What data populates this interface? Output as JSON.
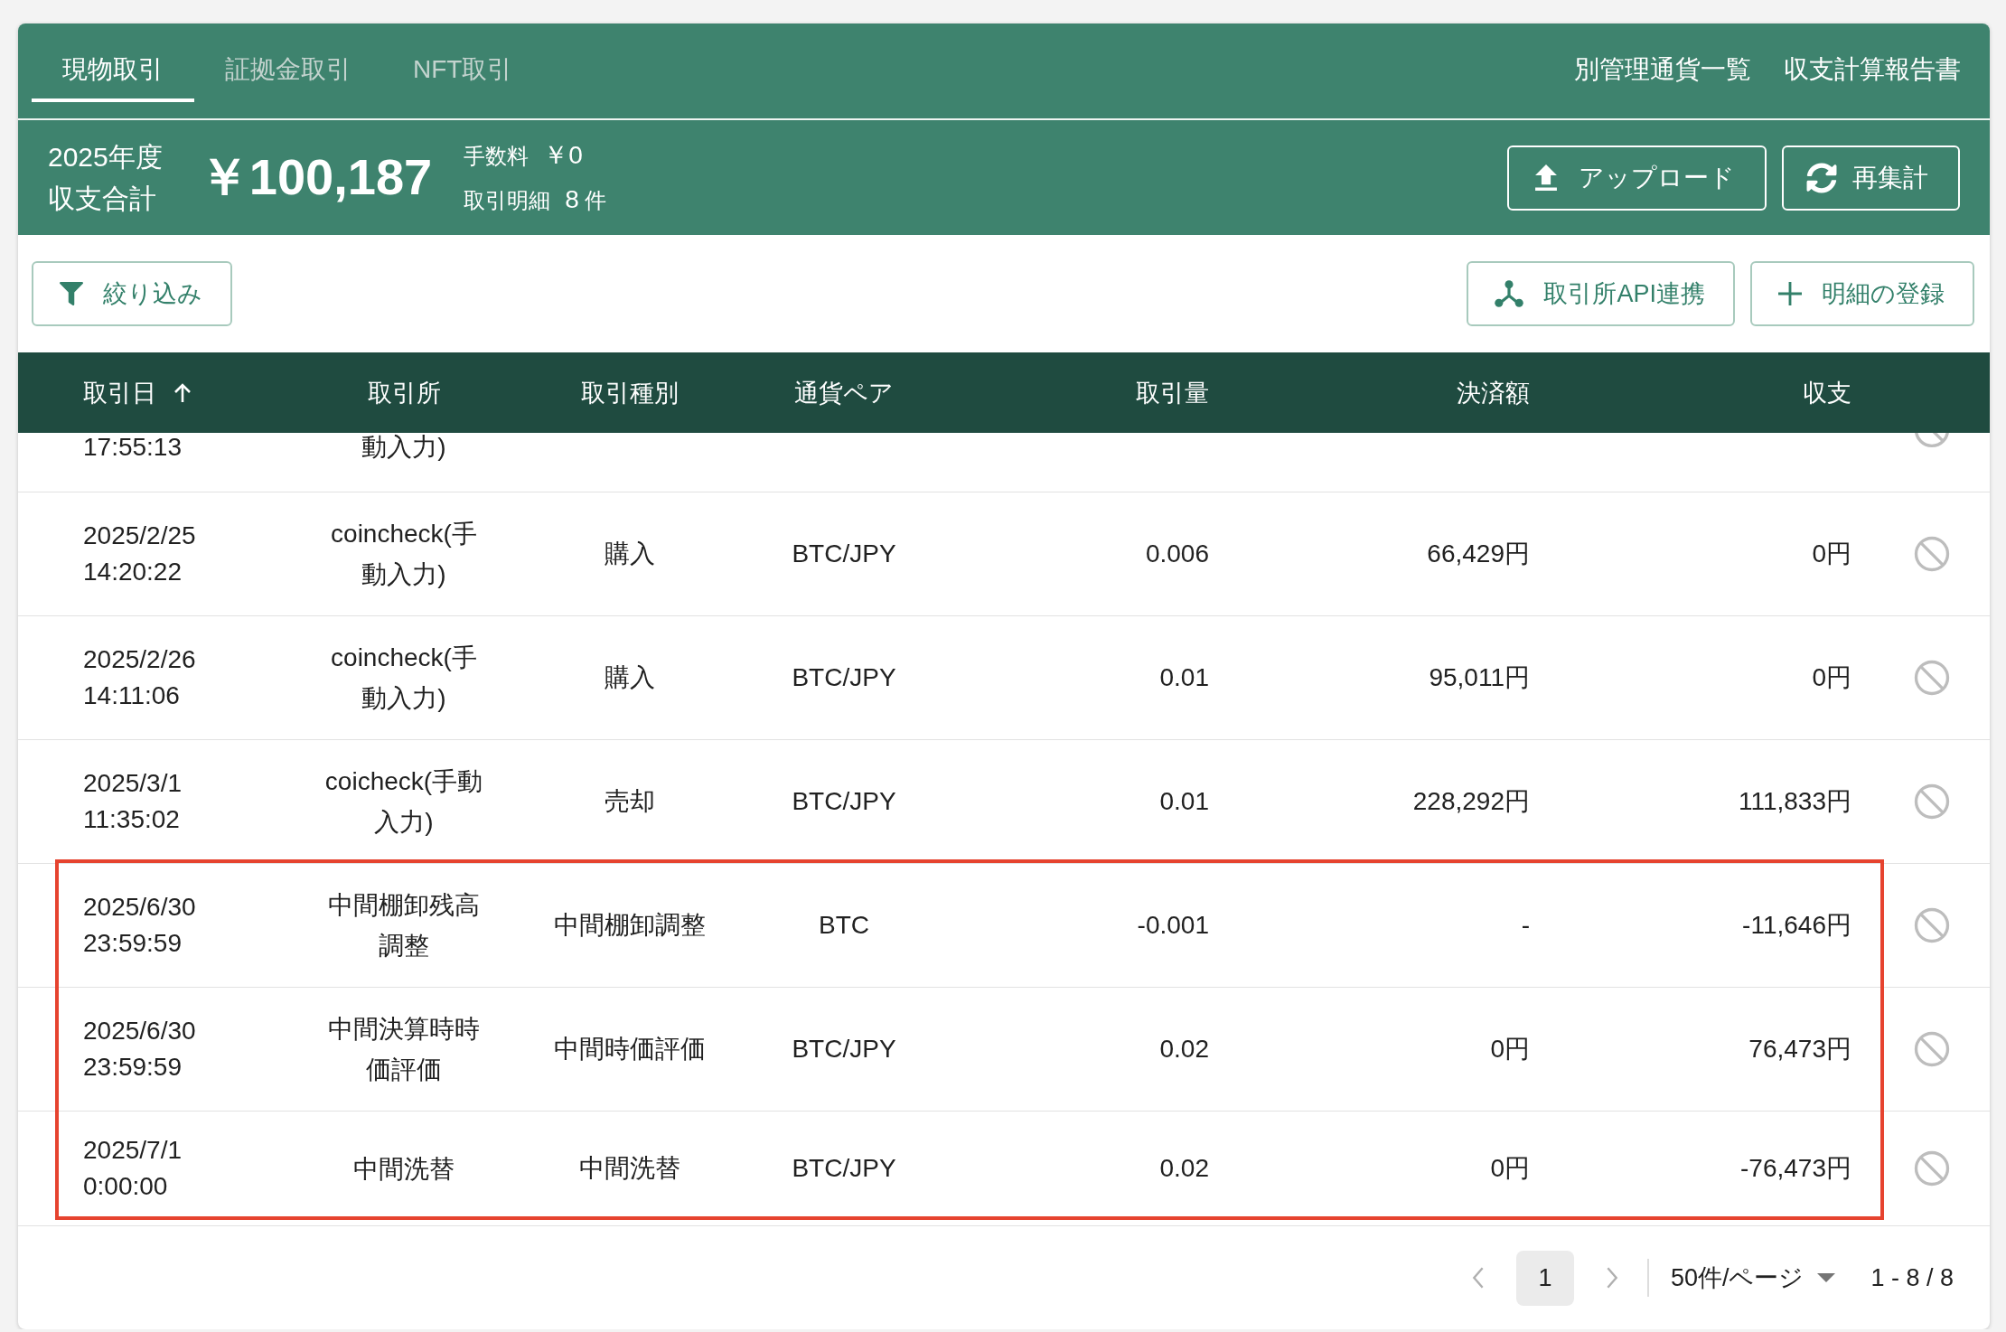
{
  "tabs": [
    {
      "label": "現物取引",
      "selected": true
    },
    {
      "label": "証拠金取引",
      "selected": false
    },
    {
      "label": "NFT取引",
      "selected": false
    }
  ],
  "header_links": [
    "別管理通貨一覧",
    "収支計算報告書"
  ],
  "summary": {
    "year": "2025年度",
    "total_label": "収支合計",
    "total": "￥100,187",
    "fee_label": "手数料",
    "fee": "￥0",
    "detail_label": "取引明細",
    "detail_count": "8",
    "detail_unit": "件",
    "upload_button": "アップロード",
    "recalculate_button": "再集計"
  },
  "toolbar": {
    "filter_button": "絞り込み",
    "api_button": "取引所API連携",
    "add_button": "明細の登録"
  },
  "table": {
    "columns": [
      {
        "label": "取引日",
        "sorted": true
      },
      {
        "label": "取引所",
        "sorted": false
      },
      {
        "label": "取引種別",
        "sorted": false
      },
      {
        "label": "通貨ペア",
        "sorted": false
      },
      {
        "label": "取引量",
        "sorted": false
      },
      {
        "label": "決済額",
        "sorted": false
      },
      {
        "label": "収支",
        "sorted": false
      }
    ],
    "rows": [
      {
        "kind": "clipped",
        "datetime": "17:55:13",
        "exchange": "動入力)",
        "highlighted": false
      },
      {
        "kind": "full",
        "datetime": "2025/2/25 14:20:22",
        "exchange": "coincheck(手動入力)",
        "type": "購入",
        "pair": "BTC/JPY",
        "volume": "0.006",
        "amount": "66,429円",
        "pnl": "0円",
        "highlighted": false
      },
      {
        "kind": "full",
        "datetime": "2025/2/26 14:11:06",
        "exchange": "coincheck(手動入力)",
        "type": "購入",
        "pair": "BTC/JPY",
        "volume": "0.01",
        "amount": "95,011円",
        "pnl": "0円",
        "highlighted": false
      },
      {
        "kind": "full",
        "datetime": "2025/3/1 11:35:02",
        "exchange": "coicheck(手動入力)",
        "type": "売却",
        "pair": "BTC/JPY",
        "volume": "0.01",
        "amount": "228,292円",
        "pnl": "111,833円",
        "highlighted": false
      },
      {
        "kind": "full",
        "datetime": "2025/6/30 23:59:59",
        "exchange": "中間棚卸残高調整",
        "type": "中間棚卸調整",
        "pair": "BTC",
        "volume": "-0.001",
        "amount": "-",
        "pnl": "-11,646円",
        "highlighted": true
      },
      {
        "kind": "full",
        "datetime": "2025/6/30 23:59:59",
        "exchange": "中間決算時時価評価",
        "type": "中間時価評価",
        "pair": "BTC/JPY",
        "volume": "0.02",
        "amount": "0円",
        "pnl": "76,473円",
        "highlighted": true
      },
      {
        "kind": "full",
        "datetime": "2025/7/1 0:00:00",
        "exchange": "中間洗替",
        "type": "中間洗替",
        "pair": "BTC/JPY",
        "volume": "0.02",
        "amount": "0円",
        "pnl": "-76,473円",
        "highlighted": true
      }
    ]
  },
  "pagination": {
    "prev": {
      "disabled": true
    },
    "pages": [
      {
        "label": "1",
        "selected": true
      }
    ],
    "next": {
      "disabled": true
    },
    "page_size": "50件/ページ",
    "range": "1 - 8 / 8"
  }
}
